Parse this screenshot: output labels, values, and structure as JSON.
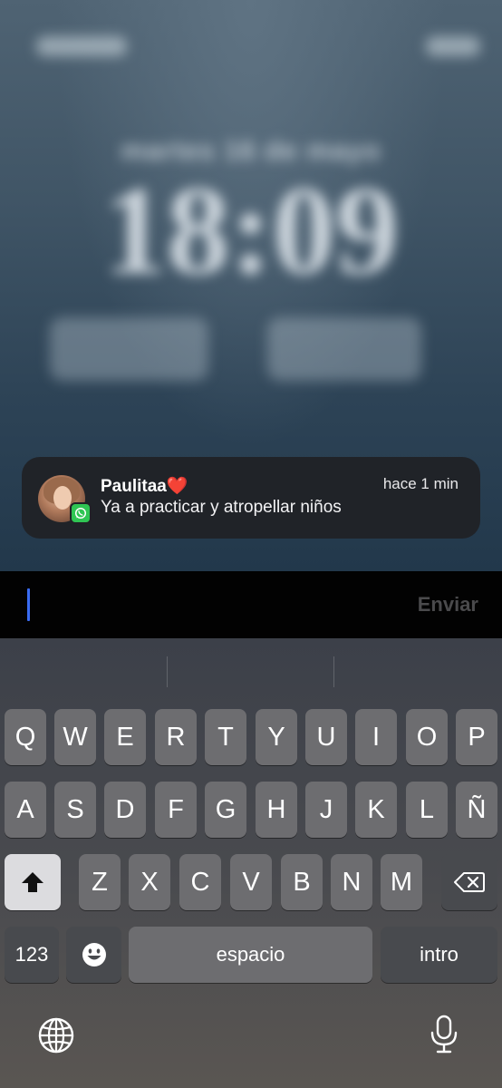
{
  "lock_screen": {
    "date": "martes 16 de mayo",
    "time": "18:09"
  },
  "notification": {
    "sender": "Paulitaa❤️",
    "time_ago": "hace 1 min",
    "message": "Ya a practicar y atropellar niños",
    "app_icon": "whatsapp-icon"
  },
  "reply": {
    "input_value": "",
    "send_label": "Enviar"
  },
  "keyboard": {
    "row1": [
      "Q",
      "W",
      "E",
      "R",
      "T",
      "Y",
      "U",
      "I",
      "O",
      "P"
    ],
    "row2": [
      "A",
      "S",
      "D",
      "F",
      "G",
      "H",
      "J",
      "K",
      "L",
      "Ñ"
    ],
    "row3": [
      "Z",
      "X",
      "C",
      "V",
      "B",
      "N",
      "M"
    ],
    "numbers_label": "123",
    "space_label": "espacio",
    "return_label": "intro",
    "shift_icon": "shift-icon",
    "delete_icon": "delete-icon",
    "emoji_icon": "emoji-icon",
    "globe_icon": "globe-icon",
    "mic_icon": "microphone-icon"
  },
  "colors": {
    "cursor": "#3a6cf3",
    "whatsapp": "#2fc553",
    "notification_bg": "#202226"
  }
}
